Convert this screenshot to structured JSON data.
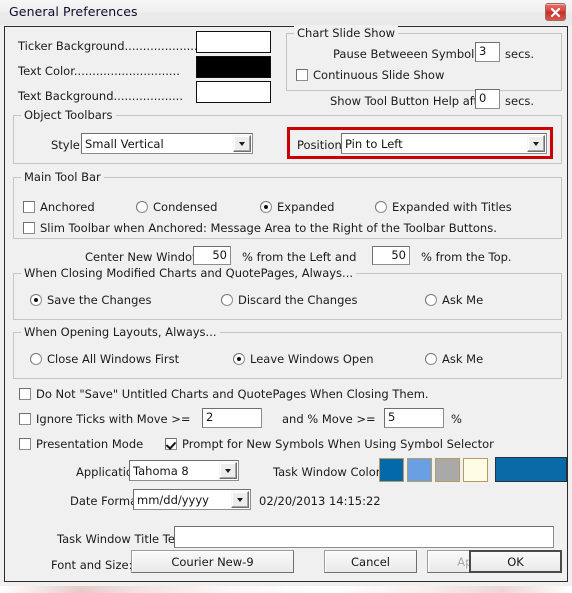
{
  "window": {
    "title": "General Preferences",
    "close_icon": "close-x-icon",
    "close_color": "#c22f28"
  },
  "colors": {
    "red_highlight": "#cc0000",
    "ticker_background": "#ffffff",
    "text_color": "#000000",
    "text_background": "#ffffff"
  },
  "color_rows": [
    {
      "label": "Ticker Background....................",
      "value": "#ffffff"
    },
    {
      "label": "Text Color.............................",
      "value": "#000000"
    },
    {
      "label": "Text Background...................",
      "value": "#ffffff"
    }
  ],
  "chart_slide_show": {
    "title": "Chart Slide Show",
    "pause_label": "Pause Betweeen Symbols:",
    "pause_value": "3",
    "pause_units": "secs.",
    "continuous_label": "Continuous Slide Show",
    "continuous_checked": false
  },
  "tool_help": {
    "label": "Show Tool Button Help after:",
    "value": "0",
    "units": "secs."
  },
  "object_toolbars": {
    "title": "Object Toolbars",
    "style_label": "Style:",
    "style_value": "Small Vertical",
    "position_label": "Position:",
    "position_value": "Pin to Left"
  },
  "main_tool_bar": {
    "title": "Main Tool Bar",
    "anchored_label": "Anchored",
    "anchored_checked": false,
    "options": [
      {
        "label": "Condensed",
        "selected": false
      },
      {
        "label": "Expanded",
        "selected": true
      },
      {
        "label": "Expanded with Titles",
        "selected": false
      }
    ],
    "slim_label": "Slim Toolbar when Anchored: Message Area to the Right of the Toolbar Buttons.",
    "slim_checked": false
  },
  "center_windows": {
    "label": "Center New Windows",
    "left_value": "50",
    "mid_label": "% from the Left and",
    "top_value": "50",
    "end_label": "% from the Top."
  },
  "closing_modified": {
    "title": "When Closing Modified Charts and QuotePages, Always...",
    "options": [
      {
        "label": "Save the Changes",
        "selected": true
      },
      {
        "label": "Discard the Changes",
        "selected": false
      },
      {
        "label": "Ask Me",
        "selected": false
      }
    ]
  },
  "opening_layouts": {
    "title": "When Opening Layouts, Always...",
    "options": [
      {
        "label": "Close All Windows First",
        "selected": false
      },
      {
        "label": "Leave Windows Open",
        "selected": true
      },
      {
        "label": "Ask Me",
        "selected": false
      }
    ]
  },
  "misc": {
    "do_not_save_label": "Do Not \"Save\" Untitled Charts and QuotePages When Closing Them.",
    "do_not_save_checked": false,
    "ignore_ticks_label": "Ignore Ticks with Move >=",
    "ignore_ticks_checked": false,
    "ignore_ticks_value": "2",
    "and_move_label": "and % Move >=",
    "pct_move_value": "5",
    "pct_symbol": "%",
    "presentation_label": "Presentation Mode",
    "presentation_checked": false,
    "prompt_label": "Prompt for New Symbols When Using Symbol Selector",
    "prompt_checked": true
  },
  "app_font": {
    "label": "Application Font:",
    "value": "Tahoma 8"
  },
  "task_window_color": {
    "label": "Task Window Color:",
    "swatches": [
      "#0469a8",
      "#6b9fe4",
      "#a9a9a9",
      "#fffce6"
    ],
    "preview": "#0a6aa8"
  },
  "date_format": {
    "label": "Date Format:",
    "value": "mm/dd/yyyy",
    "sample": "02/20/2013 14:15:22"
  },
  "task_title": {
    "label": "Task Window Title Text:",
    "value": "",
    "placeholder": ""
  },
  "footer": {
    "font_size_label": "Font and Size:",
    "font_button": "Courier New-9",
    "cancel": "Cancel",
    "apply": "Apply",
    "apply_disabled": true,
    "ok": "OK"
  }
}
